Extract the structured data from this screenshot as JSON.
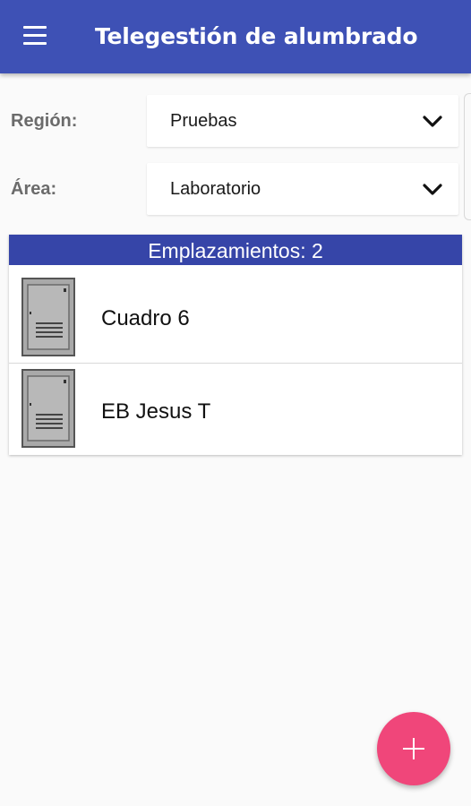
{
  "app_bar": {
    "title": "Telegestión de alumbrado",
    "menu_icon": "hamburger-menu-icon",
    "background_color": "#3e51b5"
  },
  "filters": {
    "region": {
      "label": "Región:",
      "value": "Pruebas"
    },
    "area": {
      "label": "Área:",
      "value": "Laboratorio"
    }
  },
  "locations": {
    "header": "Emplazamientos: 2",
    "header_color": "#3645a8",
    "items": [
      {
        "name": "Cuadro 6",
        "icon": "electrical-cabinet-icon"
      },
      {
        "name": "EB Jesus T",
        "icon": "electrical-cabinet-icon"
      }
    ]
  },
  "fab": {
    "icon": "plus-icon",
    "color": "#f0467a"
  }
}
